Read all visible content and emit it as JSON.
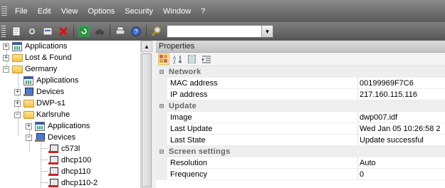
{
  "menubar": {
    "items": [
      "File",
      "Edit",
      "View",
      "Options",
      "Security",
      "Window",
      "?"
    ]
  },
  "toolbar": {
    "search_value": ""
  },
  "tree": {
    "nodes": [
      {
        "label": "Applications",
        "icon": "applications-icon",
        "expander": "+"
      },
      {
        "label": "Lost & Found",
        "icon": "folder-icon",
        "expander": "+"
      },
      {
        "label": "Germany",
        "icon": "folder-icon",
        "expander": "−"
      },
      {
        "label": "Applications",
        "icon": "applications-icon",
        "expander": ""
      },
      {
        "label": "Devices",
        "icon": "devices-icon",
        "expander": "+"
      },
      {
        "label": "DWP-s1",
        "icon": "folder-icon",
        "expander": "+"
      },
      {
        "label": "Karlsruhe",
        "icon": "folder-icon",
        "expander": "−"
      },
      {
        "label": "Applications",
        "icon": "applications-icon",
        "expander": "+"
      },
      {
        "label": "Devices",
        "icon": "devices-icon",
        "expander": "−"
      },
      {
        "label": "c573l",
        "icon": "device-red-icon",
        "expander": ""
      },
      {
        "label": "dhcp100",
        "icon": "device-red-icon",
        "expander": ""
      },
      {
        "label": "dhcp110",
        "icon": "device-red-icon",
        "expander": ""
      },
      {
        "label": "dhcp110-2",
        "icon": "device-red-icon",
        "expander": ""
      }
    ]
  },
  "properties": {
    "title": "Properties",
    "categories": [
      {
        "name": "Network",
        "rows": [
          {
            "name": "MAC address",
            "value": "00199969F7C6"
          },
          {
            "name": "IP address",
            "value": "217.160.115.116"
          }
        ]
      },
      {
        "name": "Update",
        "rows": [
          {
            "name": "Image",
            "value": "dwp007.idf"
          },
          {
            "name": "Last Update",
            "value": "Wed Jan 05 10:26:58 2"
          },
          {
            "name": "Last State",
            "value": "Update successful"
          }
        ]
      },
      {
        "name": "Screen settings",
        "rows": [
          {
            "name": "Resolution",
            "value": "Auto"
          },
          {
            "name": "Frequency",
            "value": "0"
          }
        ]
      }
    ]
  }
}
